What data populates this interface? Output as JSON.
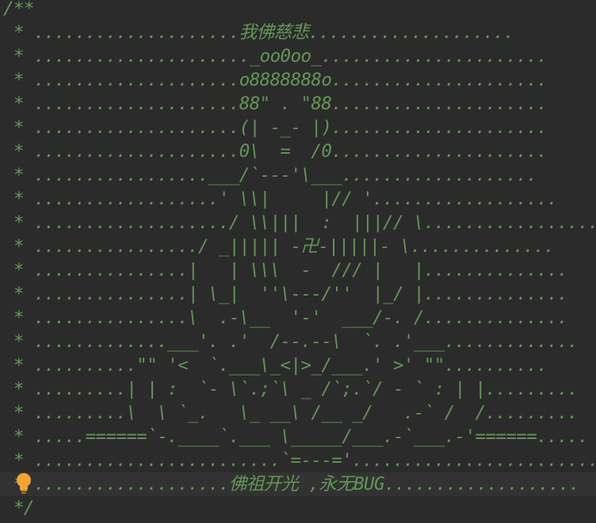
{
  "editor": {
    "lines": [
      "/**",
      " * ....................我佛慈悲....................",
      " * ....................._oo0oo_......................",
      " * ....................o8888888o.....................",
      " * ....................88\" . \"88.....................",
      " * ....................(| -_- |).....................",
      " * ....................0\\  =  /0.....................",
      " * .................___/`---'\\___...................",
      " * ..................' \\\\|     |// '..................",
      " * .................../ \\\\|||  :  |||// \\.................",
      " * ................/ _||||| -卍-|||||- \\..............",
      " * ...............|   | \\\\\\  -  /// |   |..............",
      " * ...............| \\_|  ''\\---/''  |_/ |..............",
      " * ...............\\  .-\\__  '-'  ___/-. /..............",
      " * .............___'. .'  /--.--\\  `. .'___.............",
      " * ..........\"\" '<  `.___\\_<|>_/___.' >' \"\"..........",
      " * .........| | :  `- \\`.;`\\ _ /`;.`/ - ` : | |.........",
      " * .........\\  \\ `_.   \\_ __\\ /__ _/   .-` /  /.........",
      " * .....======`-.____`.___ \\_____/___.-`___.-'======.....",
      " * ........................`=---='........................",
      " * ...................佛祖开光 ,永无BUG...................",
      " */"
    ]
  },
  "colors": {
    "background": "#2b2b2b",
    "doc_comment": "#629755",
    "current_line": "#323232",
    "bulb": "#f2a533"
  },
  "icons": {
    "intention_bulb": "lightbulb-icon"
  }
}
